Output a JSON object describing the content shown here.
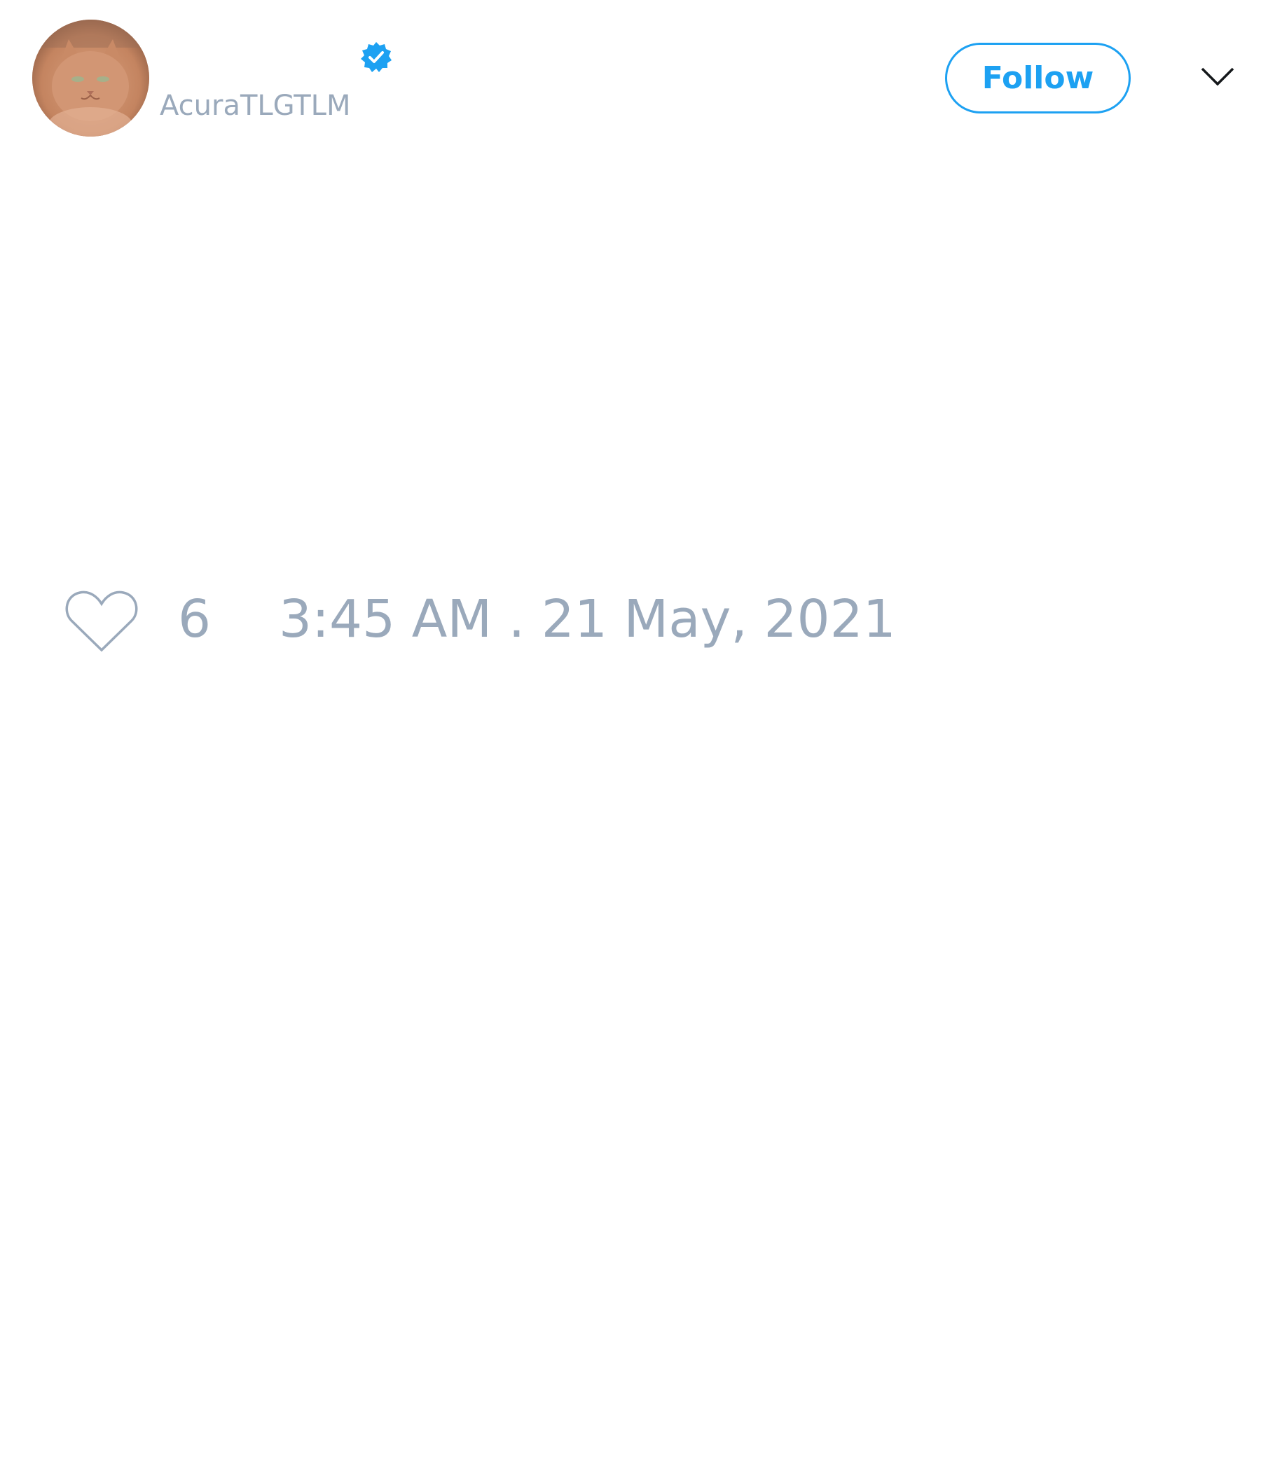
{
  "tweet": {
    "author": {
      "display_name": "",
      "handle": "AcuraTLGTLM",
      "verified": true,
      "avatar_icon": "cat-avatar"
    },
    "follow_label": "Follow",
    "menu_icon": "chevron-down-icon",
    "like_icon": "heart-outline-icon",
    "like_count": "6",
    "timestamp": "3:45 AM . 21 May, 2021"
  },
  "colors": {
    "accent": "#1da1f2",
    "muted_text": "#9aa9bb",
    "background": "#ffffff"
  }
}
